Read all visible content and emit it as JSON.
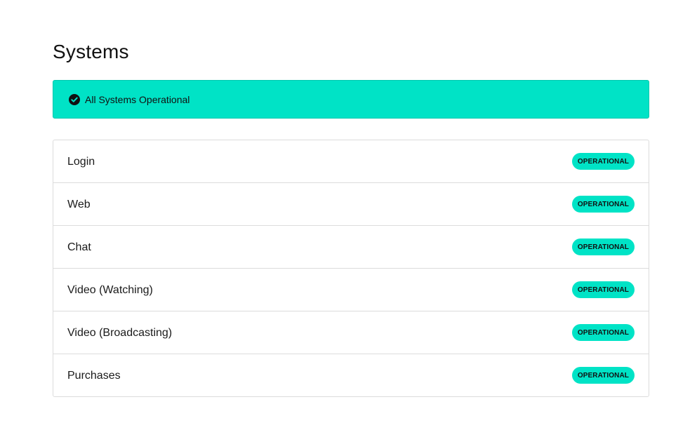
{
  "page": {
    "title": "Systems"
  },
  "banner": {
    "icon": "check-circle-icon",
    "text": "All Systems Operational",
    "color": "#00e3c6"
  },
  "systems": [
    {
      "name": "Login",
      "status": "OPERATIONAL"
    },
    {
      "name": "Web",
      "status": "OPERATIONAL"
    },
    {
      "name": "Chat",
      "status": "OPERATIONAL"
    },
    {
      "name": "Video (Watching)",
      "status": "OPERATIONAL"
    },
    {
      "name": "Video (Broadcasting)",
      "status": "OPERATIONAL"
    },
    {
      "name": "Purchases",
      "status": "OPERATIONAL"
    }
  ],
  "colors": {
    "accent": "#00e3c6",
    "border": "#dcdcdc",
    "text": "#1a1a1a"
  }
}
